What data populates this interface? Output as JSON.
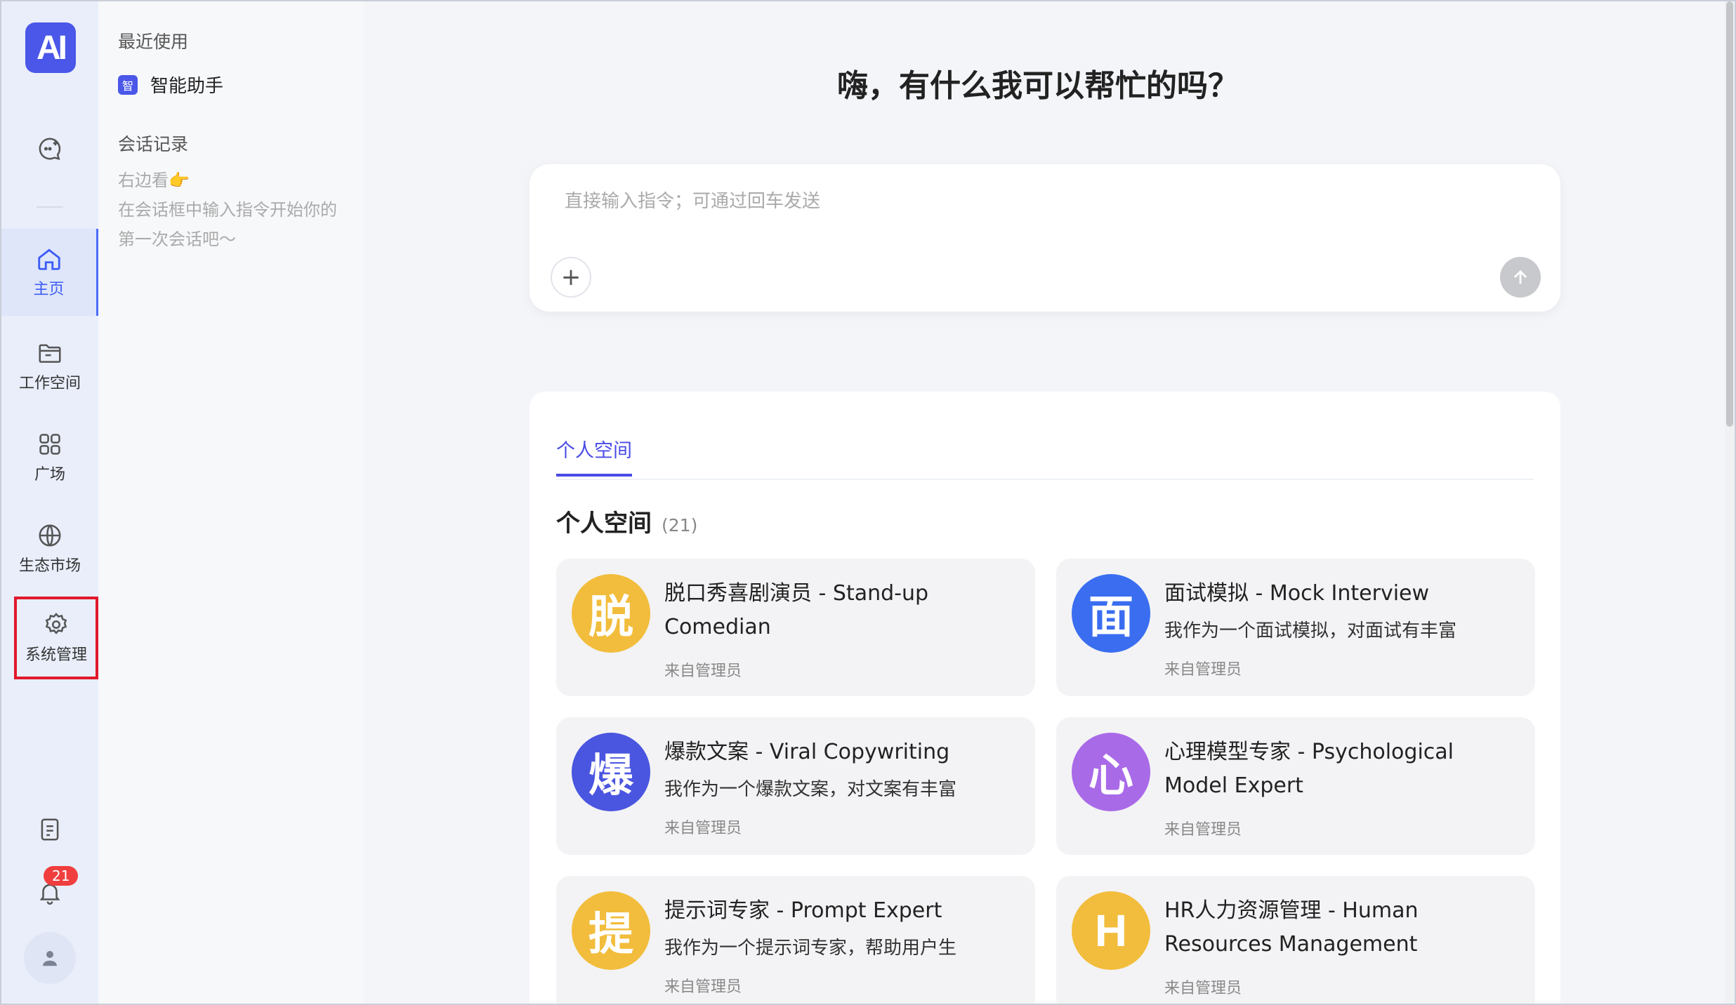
{
  "app": {
    "logo_text": "AI"
  },
  "rail": {
    "nav": [
      {
        "label": "主页"
      },
      {
        "label": "工作空间"
      },
      {
        "label": "广场"
      },
      {
        "label": "生态市场"
      },
      {
        "label": "系统管理"
      }
    ],
    "notification_count": "21"
  },
  "sidebar": {
    "recent_title": "最近使用",
    "recent_items": [
      {
        "icon_text": "智",
        "label": "智能助手"
      }
    ],
    "history_title": "会话记录",
    "history_hint_line1": "右边看👉",
    "history_hint_line2": "在会话框中输入指令开始你的第一次会话吧～"
  },
  "main": {
    "greeting": "嗨，有什么我可以帮忙的吗？",
    "input_placeholder": "直接输入指令；可通过回车发送",
    "plus_label": "+",
    "tab_label": "个人空间",
    "section_title": "个人空间",
    "section_count": "(21)",
    "cards": [
      {
        "avatar_char": "脱",
        "avatar_color": "#f2bd3c",
        "title": "脱口秀喜剧演员 - Stand-up Comedian",
        "desc": "",
        "from": "来自管理员"
      },
      {
        "avatar_char": "面",
        "avatar_color": "#3a6df0",
        "title": "面试模拟 - Mock Interview",
        "desc": "我作为一个面试模拟，对面试有丰富",
        "from": "来自管理员"
      },
      {
        "avatar_char": "爆",
        "avatar_color": "#4a55e0",
        "title": "爆款文案 - Viral Copywriting",
        "desc": "我作为一个爆款文案，对文案有丰富",
        "from": "来自管理员"
      },
      {
        "avatar_char": "心",
        "avatar_color": "#a96ae8",
        "title": "心理模型专家 - Psychological Model Expert",
        "desc": "",
        "from": "来自管理员"
      },
      {
        "avatar_char": "提",
        "avatar_color": "#f2bd3c",
        "title": "提示词专家 - Prompt Expert",
        "desc": "我作为一个提示词专家，帮助用户生",
        "from": "来自管理员"
      },
      {
        "avatar_char": "H",
        "avatar_color": "#f2bd3c",
        "title": "HR人力资源管理 - Human Resources Management",
        "desc": "",
        "from": "来自管理员"
      }
    ]
  }
}
